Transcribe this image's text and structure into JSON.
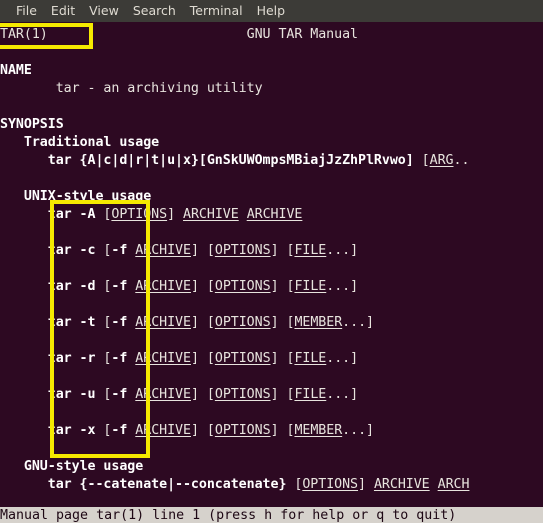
{
  "window": {
    "title": "Terminal",
    "background_color": "#2d0922",
    "foreground_color": "#e8e4de",
    "menubar_color": "#3c3b37",
    "highlight_color": "#f5ea00"
  },
  "menubar": {
    "items": [
      {
        "label": "File"
      },
      {
        "label": "Edit"
      },
      {
        "label": "View"
      },
      {
        "label": "Search"
      },
      {
        "label": "Terminal"
      },
      {
        "label": "Help"
      }
    ]
  },
  "manpage": {
    "header_left": "TAR(1)",
    "header_center": "GNU TAR Manual",
    "lines": [
      {
        "id": "l00",
        "segments": [
          {
            "t": "TAR(1)",
            "s": "plain"
          },
          {
            "t": "                         ",
            "s": "plain"
          },
          {
            "t": "GNU TAR Manual",
            "s": "plain"
          }
        ]
      },
      {
        "id": "l01",
        "segments": []
      },
      {
        "id": "l02",
        "segments": [
          {
            "t": "NAME",
            "s": "b"
          }
        ]
      },
      {
        "id": "l03",
        "segments": [
          {
            "t": "       tar - an archiving utility",
            "s": "plain"
          }
        ]
      },
      {
        "id": "l04",
        "segments": []
      },
      {
        "id": "l05",
        "segments": [
          {
            "t": "SYNOPSIS",
            "s": "b"
          }
        ]
      },
      {
        "id": "l06",
        "segments": [
          {
            "t": "   ",
            "s": "plain"
          },
          {
            "t": "Traditional usage",
            "s": "b"
          }
        ]
      },
      {
        "id": "l07",
        "segments": [
          {
            "t": "      ",
            "s": "plain"
          },
          {
            "t": "tar {A|c|d|r|t|u|x}[GnSkUWOmpsMBiajJzZhPlRvwo]",
            "s": "b"
          },
          {
            "t": " [",
            "s": "plain"
          },
          {
            "t": "ARG",
            "s": "u"
          },
          {
            "t": "..",
            "s": "plain"
          }
        ]
      },
      {
        "id": "l08",
        "segments": []
      },
      {
        "id": "l09",
        "segments": [
          {
            "t": "   ",
            "s": "plain"
          },
          {
            "t": "UNIX-style usage",
            "s": "b"
          }
        ]
      },
      {
        "id": "l10",
        "segments": [
          {
            "t": "      ",
            "s": "plain"
          },
          {
            "t": "tar -A",
            "s": "b"
          },
          {
            "t": " [",
            "s": "plain"
          },
          {
            "t": "OPTIONS",
            "s": "u"
          },
          {
            "t": "] ",
            "s": "plain"
          },
          {
            "t": "ARCHIVE",
            "s": "u"
          },
          {
            "t": " ",
            "s": "plain"
          },
          {
            "t": "ARCHIVE",
            "s": "u"
          }
        ]
      },
      {
        "id": "l11",
        "segments": []
      },
      {
        "id": "l12",
        "segments": [
          {
            "t": "      ",
            "s": "plain"
          },
          {
            "t": "tar -c",
            "s": "b"
          },
          {
            "t": " [",
            "s": "plain"
          },
          {
            "t": "-f",
            "s": "b"
          },
          {
            "t": " ",
            "s": "plain"
          },
          {
            "t": "ARCHIVE",
            "s": "u"
          },
          {
            "t": "] [",
            "s": "plain"
          },
          {
            "t": "OPTIONS",
            "s": "u"
          },
          {
            "t": "] [",
            "s": "plain"
          },
          {
            "t": "FILE",
            "s": "u"
          },
          {
            "t": "...]",
            "s": "plain"
          }
        ]
      },
      {
        "id": "l13",
        "segments": []
      },
      {
        "id": "l14",
        "segments": [
          {
            "t": "      ",
            "s": "plain"
          },
          {
            "t": "tar -d",
            "s": "b"
          },
          {
            "t": " [",
            "s": "plain"
          },
          {
            "t": "-f",
            "s": "b"
          },
          {
            "t": " ",
            "s": "plain"
          },
          {
            "t": "ARCHIVE",
            "s": "u"
          },
          {
            "t": "] [",
            "s": "plain"
          },
          {
            "t": "OPTIONS",
            "s": "u"
          },
          {
            "t": "] [",
            "s": "plain"
          },
          {
            "t": "FILE",
            "s": "u"
          },
          {
            "t": "...]",
            "s": "plain"
          }
        ]
      },
      {
        "id": "l15",
        "segments": []
      },
      {
        "id": "l16",
        "segments": [
          {
            "t": "      ",
            "s": "plain"
          },
          {
            "t": "tar -t",
            "s": "b"
          },
          {
            "t": " [",
            "s": "plain"
          },
          {
            "t": "-f",
            "s": "b"
          },
          {
            "t": " ",
            "s": "plain"
          },
          {
            "t": "ARCHIVE",
            "s": "u"
          },
          {
            "t": "] [",
            "s": "plain"
          },
          {
            "t": "OPTIONS",
            "s": "u"
          },
          {
            "t": "] [",
            "s": "plain"
          },
          {
            "t": "MEMBER",
            "s": "u"
          },
          {
            "t": "...]",
            "s": "plain"
          }
        ]
      },
      {
        "id": "l17",
        "segments": []
      },
      {
        "id": "l18",
        "segments": [
          {
            "t": "      ",
            "s": "plain"
          },
          {
            "t": "tar -r",
            "s": "b"
          },
          {
            "t": " [",
            "s": "plain"
          },
          {
            "t": "-f",
            "s": "b"
          },
          {
            "t": " ",
            "s": "plain"
          },
          {
            "t": "ARCHIVE",
            "s": "u"
          },
          {
            "t": "] [",
            "s": "plain"
          },
          {
            "t": "OPTIONS",
            "s": "u"
          },
          {
            "t": "] [",
            "s": "plain"
          },
          {
            "t": "FILE",
            "s": "u"
          },
          {
            "t": "...]",
            "s": "plain"
          }
        ]
      },
      {
        "id": "l19",
        "segments": []
      },
      {
        "id": "l20",
        "segments": [
          {
            "t": "      ",
            "s": "plain"
          },
          {
            "t": "tar -u",
            "s": "b"
          },
          {
            "t": " [",
            "s": "plain"
          },
          {
            "t": "-f",
            "s": "b"
          },
          {
            "t": " ",
            "s": "plain"
          },
          {
            "t": "ARCHIVE",
            "s": "u"
          },
          {
            "t": "] [",
            "s": "plain"
          },
          {
            "t": "OPTIONS",
            "s": "u"
          },
          {
            "t": "] [",
            "s": "plain"
          },
          {
            "t": "FILE",
            "s": "u"
          },
          {
            "t": "...]",
            "s": "plain"
          }
        ]
      },
      {
        "id": "l21",
        "segments": []
      },
      {
        "id": "l22",
        "segments": [
          {
            "t": "      ",
            "s": "plain"
          },
          {
            "t": "tar -x",
            "s": "b"
          },
          {
            "t": " [",
            "s": "plain"
          },
          {
            "t": "-f",
            "s": "b"
          },
          {
            "t": " ",
            "s": "plain"
          },
          {
            "t": "ARCHIVE",
            "s": "u"
          },
          {
            "t": "] [",
            "s": "plain"
          },
          {
            "t": "OPTIONS",
            "s": "u"
          },
          {
            "t": "] [",
            "s": "plain"
          },
          {
            "t": "MEMBER",
            "s": "u"
          },
          {
            "t": "...]",
            "s": "plain"
          }
        ]
      },
      {
        "id": "l23",
        "segments": []
      },
      {
        "id": "l24",
        "segments": [
          {
            "t": "   ",
            "s": "plain"
          },
          {
            "t": "GNU-style usage",
            "s": "b"
          }
        ]
      },
      {
        "id": "l25",
        "segments": [
          {
            "t": "      ",
            "s": "plain"
          },
          {
            "t": "tar {--catenate|--concatenate}",
            "s": "b"
          },
          {
            "t": " [",
            "s": "plain"
          },
          {
            "t": "OPTIONS",
            "s": "u"
          },
          {
            "t": "] ",
            "s": "plain"
          },
          {
            "t": "ARCHIVE",
            "s": "u"
          },
          {
            "t": " ",
            "s": "plain"
          },
          {
            "t": "ARCH",
            "s": "u"
          }
        ]
      }
    ]
  },
  "statusbar": {
    "text": "Manual page tar(1) line 1 (press h for help or q to quit)"
  },
  "annotations": [
    {
      "name": "highlight-box-tar-title",
      "target": "TAR(1)"
    },
    {
      "name": "highlight-box-unix-style-commands",
      "target": "tar -A/-c/-d/-t/-r/-u/-x"
    }
  ]
}
